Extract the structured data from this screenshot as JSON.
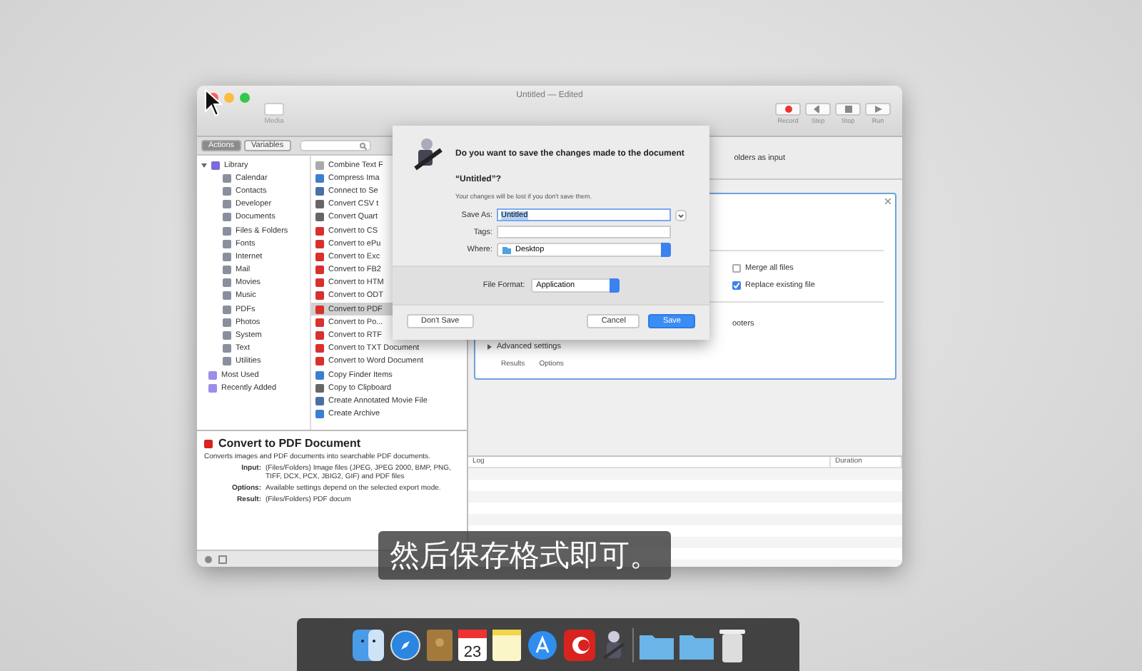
{
  "window": {
    "title": "Untitled — Edited"
  },
  "toolbar": {
    "library_button": "Media",
    "buttons": [
      {
        "label": "Record",
        "kind": "record"
      },
      {
        "label": "Step",
        "kind": "step"
      },
      {
        "label": "Stop",
        "kind": "stop"
      },
      {
        "label": "Run",
        "kind": "run"
      }
    ]
  },
  "tabs": [
    {
      "label": "Actions",
      "selected": true
    },
    {
      "label": "Variables",
      "selected": false
    }
  ],
  "library": {
    "label": "Library",
    "expanded": true,
    "children": [
      {
        "label": "Calendar"
      },
      {
        "label": "Contacts"
      },
      {
        "label": "Developer"
      },
      {
        "label": "Documents"
      },
      {
        "label": "Files & Folders"
      },
      {
        "label": "Fonts"
      },
      {
        "label": "Internet"
      },
      {
        "label": "Mail"
      },
      {
        "label": "Movies"
      },
      {
        "label": "Music"
      },
      {
        "label": "PDFs"
      },
      {
        "label": "Photos"
      },
      {
        "label": "System"
      },
      {
        "label": "Text"
      },
      {
        "label": "Utilities"
      }
    ]
  },
  "smart_groups": [
    {
      "label": "Most Used"
    },
    {
      "label": "Recently Added"
    }
  ],
  "actions": [
    {
      "label": "Combine Text F",
      "kind": "text",
      "selected": false
    },
    {
      "label": "Compress Ima",
      "kind": "finder",
      "selected": false
    },
    {
      "label": "Connect to Se",
      "kind": "internet",
      "selected": false
    },
    {
      "label": "Convert CSV t",
      "kind": "script",
      "selected": false
    },
    {
      "label": "Convert Quart",
      "kind": "script",
      "selected": false
    },
    {
      "label": "Convert to CS",
      "kind": "app",
      "selected": false
    },
    {
      "label": "Convert to ePu",
      "kind": "app",
      "selected": false
    },
    {
      "label": "Convert to Exc",
      "kind": "app",
      "selected": false
    },
    {
      "label": "Convert to FB2",
      "kind": "app",
      "selected": false
    },
    {
      "label": "Convert to HTM",
      "kind": "app",
      "selected": false
    },
    {
      "label": "Convert to ODT",
      "kind": "app",
      "selected": false
    },
    {
      "label": "Convert to PDF",
      "kind": "app",
      "selected": true
    },
    {
      "label": "Convert to Po...",
      "kind": "app",
      "selected": false
    },
    {
      "label": "Convert to RTF",
      "kind": "app",
      "selected": false
    },
    {
      "label": "Convert to TXT Document",
      "kind": "app",
      "selected": false
    },
    {
      "label": "Convert to Word Document",
      "kind": "app",
      "selected": false
    },
    {
      "label": "Copy Finder Items",
      "kind": "finder",
      "selected": false
    },
    {
      "label": "Copy to Clipboard",
      "kind": "script",
      "selected": false
    },
    {
      "label": "Create Annotated Movie File",
      "kind": "internet",
      "selected": false
    },
    {
      "label": "Create Archive",
      "kind": "finder",
      "selected": false
    }
  ],
  "description": {
    "title": "Convert to PDF Document",
    "summary": "Converts images and PDF documents into searchable PDF documents.",
    "fields": [
      {
        "label": "Input:",
        "value": "(Files/Folders) Image files (JPEG, JPEG 2000, BMP, PNG, TIFF, DCX, PCX, JBIG2, GIF) and PDF files"
      },
      {
        "label": "Options:",
        "value": "Available settings depend on the selected export mode."
      },
      {
        "label": "Result:",
        "value": "(Files/Folders) PDF docum"
      }
    ]
  },
  "workflow": {
    "input_hint": "olders as input",
    "options": [
      {
        "label": "Merge all files",
        "checked": false
      },
      {
        "label": "Replace existing file",
        "checked": true
      }
    ],
    "footers_text": "ooters",
    "advanced": {
      "label": "Advanced settings",
      "expanded": false
    },
    "tabs": [
      {
        "label": "Results"
      },
      {
        "label": "Options"
      }
    ]
  },
  "log": {
    "columns": [
      "Log",
      "Duration"
    ]
  },
  "dialog": {
    "question": "Do you want to save the changes made to the document “Untitled”?",
    "note": "Your changes will be lost if you don't save them.",
    "save_as_label": "Save As:",
    "save_as_value": "Untitled",
    "tags_label": "Tags:",
    "where_label": "Where:",
    "where_value": "Desktop",
    "format_label": "File Format:",
    "format_value": "Application",
    "buttons": [
      {
        "label": "Don't Save",
        "kind": "plain"
      },
      {
        "label": "Cancel",
        "kind": "plain"
      },
      {
        "label": "Save",
        "kind": "default"
      }
    ]
  },
  "subtitle": "然后保存格式即可。",
  "dock": [
    {
      "kind": "finder"
    },
    {
      "kind": "safari"
    },
    {
      "kind": "contacts"
    },
    {
      "kind": "calendar",
      "label": "23"
    },
    {
      "kind": "notes"
    },
    {
      "kind": "appstore"
    },
    {
      "kind": "redapp"
    },
    {
      "kind": "robot"
    },
    {
      "kind": "separator"
    },
    {
      "kind": "folder"
    },
    {
      "kind": "folder"
    },
    {
      "kind": "trash"
    }
  ]
}
